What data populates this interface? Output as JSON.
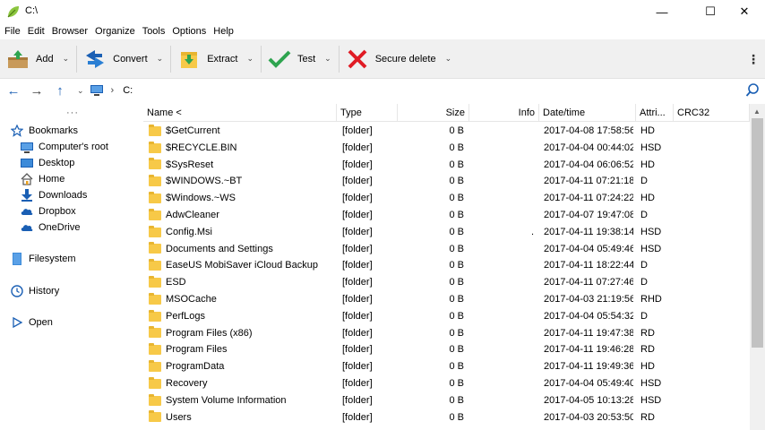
{
  "window": {
    "title": "C:\\",
    "minimize": "—",
    "maximize": "☐",
    "close": "✕"
  },
  "menu": [
    "File",
    "Edit",
    "Browser",
    "Organize",
    "Tools",
    "Options",
    "Help"
  ],
  "toolbar": {
    "add": "Add",
    "convert": "Convert",
    "extract": "Extract",
    "test": "Test",
    "secure_delete": "Secure delete",
    "caret": "⌄",
    "more": "⋮"
  },
  "address": {
    "path": "C:",
    "back": "←",
    "forward": "→",
    "up": "↑",
    "dropdown": "⌄",
    "chevron": "›"
  },
  "sidebar": {
    "dots": "···",
    "bookmarks": "Bookmarks",
    "items": [
      "Computer's root",
      "Desktop",
      "Home",
      "Downloads",
      "Dropbox",
      "OneDrive"
    ],
    "filesystem": "Filesystem",
    "history": "History",
    "open": "Open"
  },
  "columns": {
    "name": "Name <",
    "type": "Type",
    "size": "Size",
    "info": "Info",
    "date": "Date/time",
    "attr": "Attri...",
    "crc": "CRC32"
  },
  "files": [
    {
      "name": "$GetCurrent",
      "type": "[folder]",
      "size": "0 B",
      "info": "",
      "date": "2017-04-08 17:58:56",
      "attr": "HD"
    },
    {
      "name": "$RECYCLE.BIN",
      "type": "[folder]",
      "size": "0 B",
      "info": "",
      "date": "2017-04-04 00:44:02",
      "attr": "HSD"
    },
    {
      "name": "$SysReset",
      "type": "[folder]",
      "size": "0 B",
      "info": "",
      "date": "2017-04-04 06:06:52",
      "attr": "HD"
    },
    {
      "name": "$WINDOWS.~BT",
      "type": "[folder]",
      "size": "0 B",
      "info": "",
      "date": "2017-04-11 07:21:18",
      "attr": "D"
    },
    {
      "name": "$Windows.~WS",
      "type": "[folder]",
      "size": "0 B",
      "info": "",
      "date": "2017-04-11 07:24:22",
      "attr": "HD"
    },
    {
      "name": "AdwCleaner",
      "type": "[folder]",
      "size": "0 B",
      "info": "",
      "date": "2017-04-07 19:47:08",
      "attr": "D"
    },
    {
      "name": "Config.Msi",
      "type": "[folder]",
      "size": "0 B",
      "info": ".",
      "date": "2017-04-11 19:38:14",
      "attr": "HSD"
    },
    {
      "name": "Documents and Settings",
      "type": "[folder]",
      "size": "0 B",
      "info": "",
      "date": "2017-04-04 05:49:46",
      "attr": "HSD"
    },
    {
      "name": "EaseUS MobiSaver iCloud Backup",
      "type": "[folder]",
      "size": "0 B",
      "info": "",
      "date": "2017-04-11 18:22:44",
      "attr": "D"
    },
    {
      "name": "ESD",
      "type": "[folder]",
      "size": "0 B",
      "info": "",
      "date": "2017-04-11 07:27:46",
      "attr": "D"
    },
    {
      "name": "MSOCache",
      "type": "[folder]",
      "size": "0 B",
      "info": "",
      "date": "2017-04-03 21:19:56",
      "attr": "RHD"
    },
    {
      "name": "PerfLogs",
      "type": "[folder]",
      "size": "0 B",
      "info": "",
      "date": "2017-04-04 05:54:32",
      "attr": "D"
    },
    {
      "name": "Program Files (x86)",
      "type": "[folder]",
      "size": "0 B",
      "info": "",
      "date": "2017-04-11 19:47:38",
      "attr": "RD"
    },
    {
      "name": "Program Files",
      "type": "[folder]",
      "size": "0 B",
      "info": "",
      "date": "2017-04-11 19:46:28",
      "attr": "RD"
    },
    {
      "name": "ProgramData",
      "type": "[folder]",
      "size": "0 B",
      "info": "",
      "date": "2017-04-11 19:49:36",
      "attr": "HD"
    },
    {
      "name": "Recovery",
      "type": "[folder]",
      "size": "0 B",
      "info": "",
      "date": "2017-04-04 05:49:40",
      "attr": "HSD"
    },
    {
      "name": "System Volume Information",
      "type": "[folder]",
      "size": "0 B",
      "info": "",
      "date": "2017-04-05 10:13:28",
      "attr": "HSD"
    },
    {
      "name": "Users",
      "type": "[folder]",
      "size": "0 B",
      "info": "",
      "date": "2017-04-03 20:53:50",
      "attr": "RD"
    }
  ],
  "colors": {
    "accent": "#1a5fb4",
    "folder": "#f7c948",
    "toolbar_bg": "#f0f0f0",
    "delete_red": "#e01b24",
    "check_green": "#2ea44f"
  }
}
